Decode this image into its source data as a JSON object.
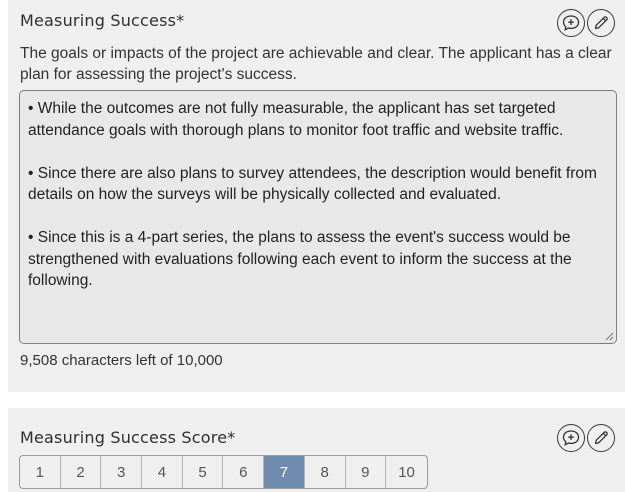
{
  "criterion": {
    "title": "Measuring Success*",
    "description": "The goals or impacts of the project are achievable and clear. The applicant has a clear plan for assessing the project's success.",
    "comment_paragraphs": [
      "• While the outcomes are not fully measurable, the applicant has set targeted attendance goals with thorough plans to monitor foot traffic and website traffic.",
      "• Since there are also plans to survey attendees, the description would benefit from details on how the surveys will be physically collected and evaluated.",
      "• Since this is a 4-part series, the plans to assess the event's success would be strengthened with evaluations following each event to inform the success at the following."
    ],
    "char_count": "9,508 characters left of 10,000",
    "icons": [
      "add-comment-icon",
      "edit-icon"
    ]
  },
  "score": {
    "title": "Measuring Success Score*",
    "options": [
      "1",
      "2",
      "3",
      "4",
      "5",
      "6",
      "7",
      "8",
      "9",
      "10"
    ],
    "selected": "7",
    "icons": [
      "add-comment-icon",
      "edit-icon"
    ]
  },
  "colors": {
    "card_bg": "#efefef",
    "selected_score": "#6f8bb0",
    "textarea_bg": "#e8e8e8"
  }
}
